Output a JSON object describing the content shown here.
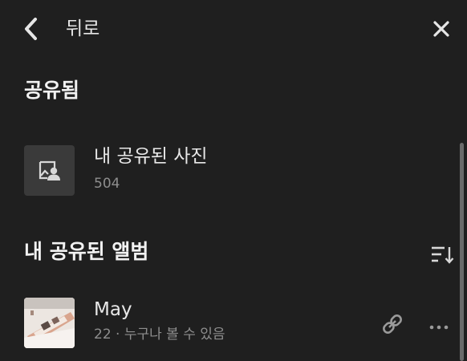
{
  "header": {
    "back_label": "뒤로",
    "back_icon": "chevron-left-icon",
    "close_icon": "close-icon"
  },
  "shared": {
    "title": "공유됨",
    "my_photos": {
      "title": "내 공유된 사진",
      "count": "504",
      "icon": "shared-photo-icon"
    }
  },
  "albums": {
    "title": "내 공유된 앨범",
    "sort_icon": "sort-icon",
    "items": [
      {
        "title": "May",
        "subtitle": "22 · 누구나 볼 수 있음",
        "link_icon": "link-icon",
        "more_icon": "more-horizontal-icon"
      }
    ]
  },
  "colors": {
    "background": "#1f1f1f",
    "text_primary": "#e8e8e8",
    "text_secondary": "#8e8e8e",
    "icon": "#d8d8d8",
    "scrollbar": "#6a6a6a"
  }
}
